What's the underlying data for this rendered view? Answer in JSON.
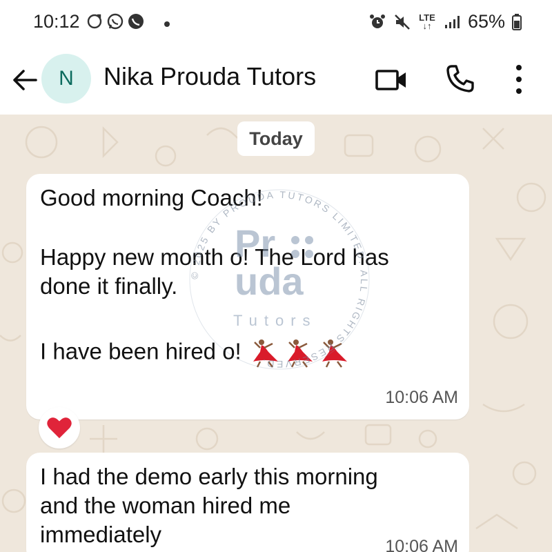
{
  "status_bar": {
    "time": "10:12",
    "left_icons": [
      "sync-icon",
      "whatsapp-icon",
      "viber-icon"
    ],
    "right_icons": [
      "alarm-icon",
      "mute-icon",
      "lte-icon",
      "signal-icon"
    ],
    "lte_label": "LTE",
    "battery_percent": "65%"
  },
  "header": {
    "avatar_initial": "N",
    "contact_name": "Nika Prouda Tutors",
    "icons": [
      "back-arrow-icon",
      "video-call-icon",
      "phone-call-icon",
      "more-vert-icon"
    ]
  },
  "chat": {
    "date_label": "Today",
    "messages": [
      {
        "lines": [
          "Good morning Coach!",
          "",
          "Happy new month o! The Lord has",
          "done it finally.",
          "",
          "I have been hired o!"
        ],
        "emoji": [
          "dancer-icon",
          "dancer-icon",
          "dancer-icon"
        ],
        "time": "10:06 AM",
        "reaction": "heart-icon"
      },
      {
        "lines": [
          "I had the demo early this morning",
          "and the woman hired me",
          "immediately"
        ],
        "time": "10:06 AM"
      }
    ]
  },
  "watermark": {
    "logo_line1": "Pr",
    "logo_line2": "uda",
    "subtitle": "Tutors",
    "ring_text": "© 2025 BY PROUDA TUTORS LIMITED. ALL RIGHTS RESERVED."
  },
  "colors": {
    "chat_background": "#efe7dc",
    "bubble": "#ffffff",
    "avatar_bg": "#d8f1ee",
    "avatar_text": "#0c6b5e",
    "heart": "#e0243a"
  }
}
